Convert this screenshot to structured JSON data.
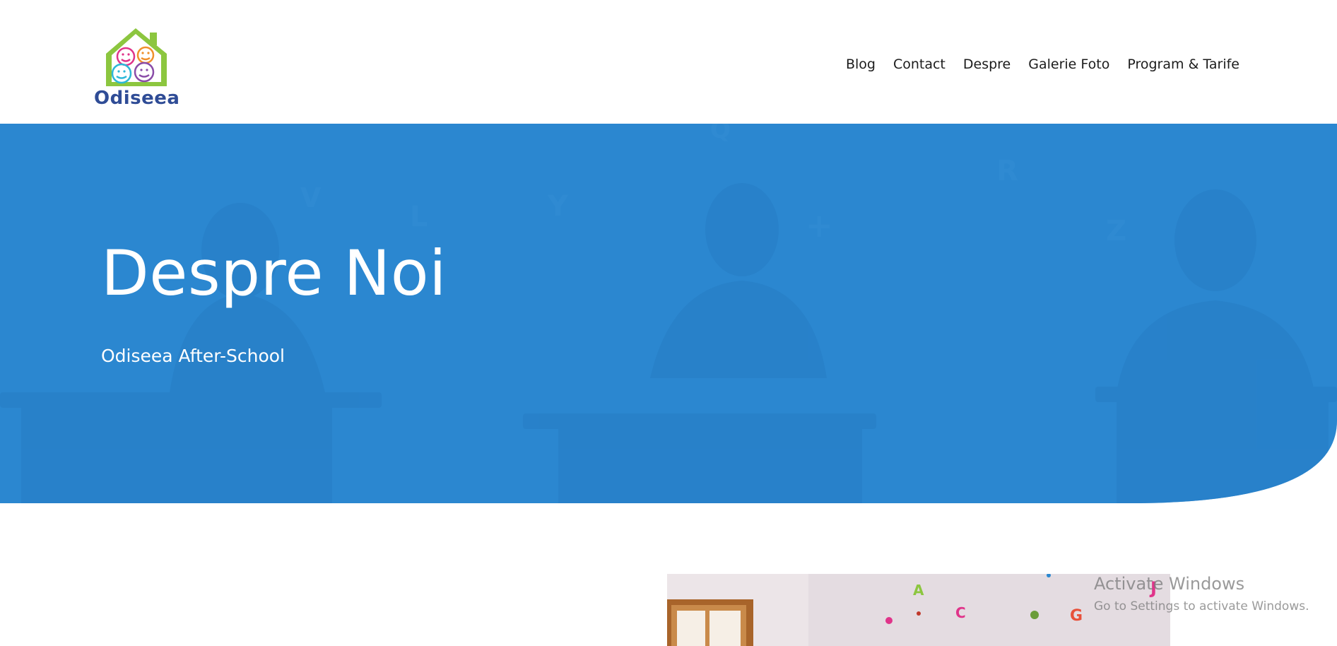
{
  "brand": {
    "name": "Odiseea"
  },
  "nav": {
    "items": [
      {
        "label": "Blog"
      },
      {
        "label": "Contact"
      },
      {
        "label": "Despre"
      },
      {
        "label": "Galerie Foto"
      },
      {
        "label": "Program & Tarife"
      }
    ]
  },
  "hero": {
    "title": "Despre Noi",
    "subtitle": "Odiseea After-School",
    "overlay_color": "#2b88d0"
  },
  "watermark": {
    "title": "Activate Windows",
    "subtitle": "Go to Settings to activate Windows."
  },
  "colors": {
    "brand_blue": "#2f4c96",
    "hero_blue": "#2b88d0",
    "logo_green": "#8cc63f"
  }
}
